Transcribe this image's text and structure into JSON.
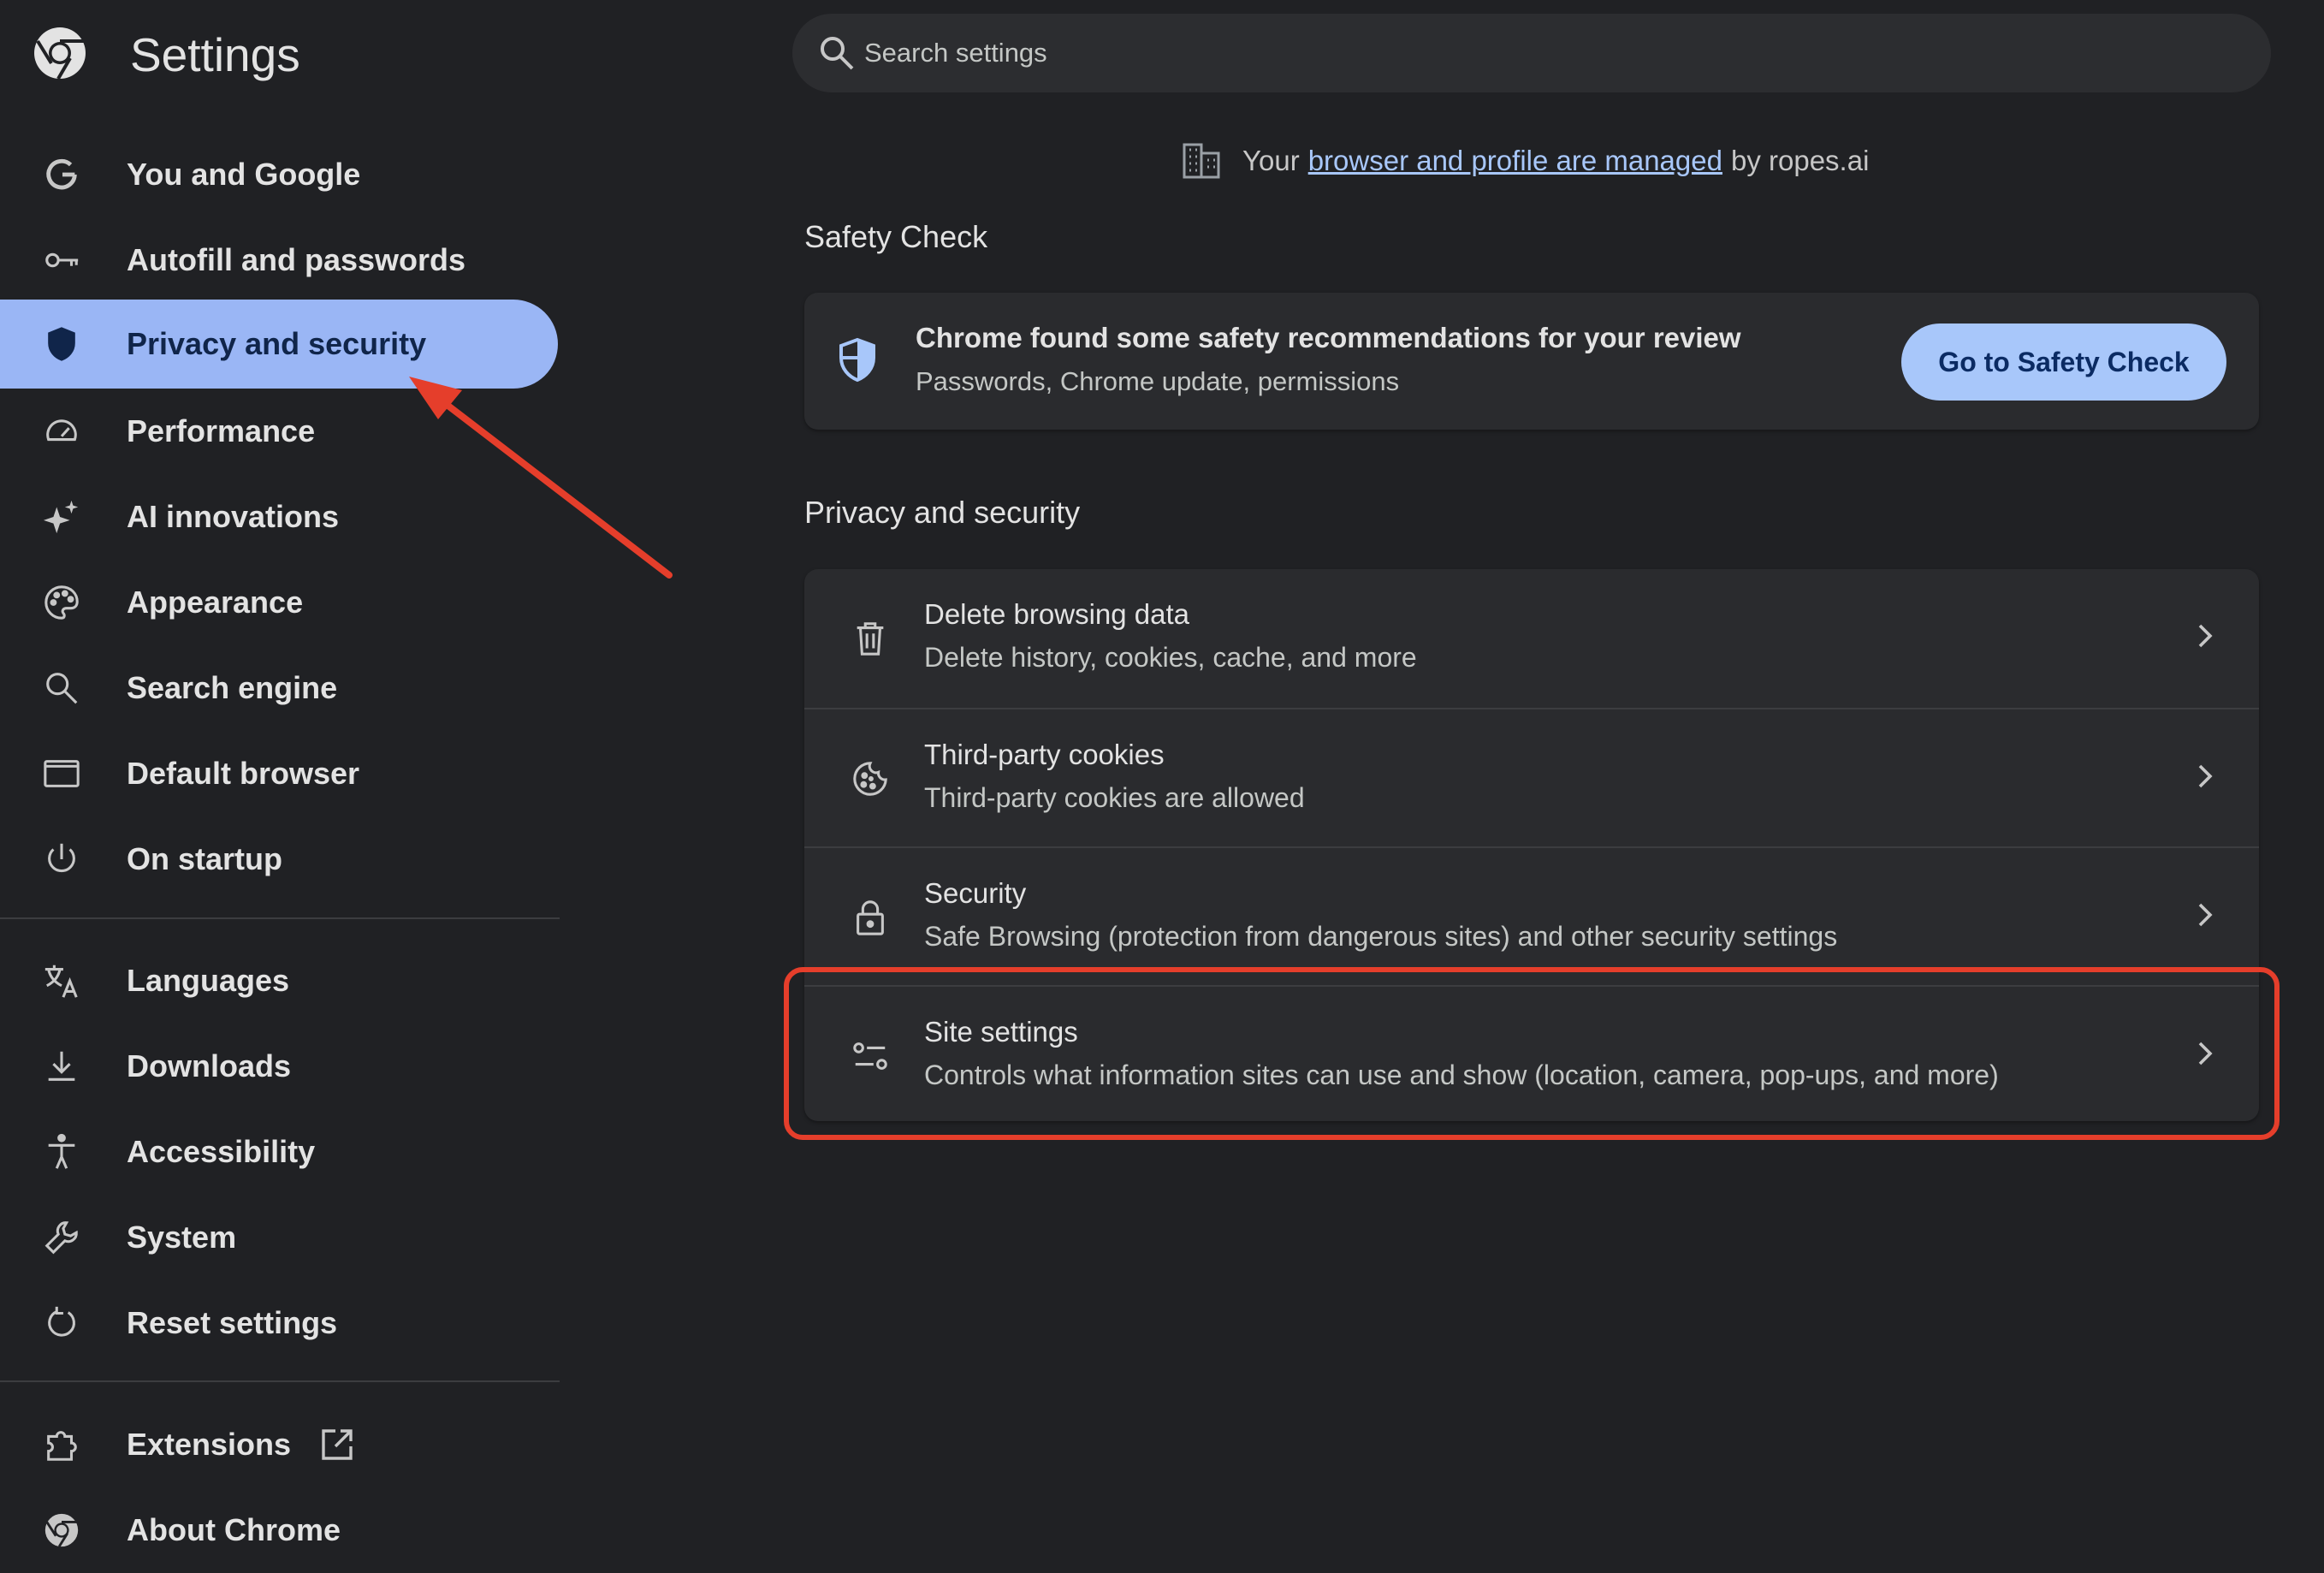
{
  "app": {
    "title": "Settings",
    "icon": "chrome-logo-icon"
  },
  "search": {
    "placeholder": "Search settings",
    "icon": "search-icon"
  },
  "sidebar": {
    "items": [
      {
        "label": "You and Google",
        "icon": "google-g-icon"
      },
      {
        "label": "Autofill and passwords",
        "icon": "key-icon"
      },
      {
        "label": "Privacy and security",
        "icon": "shield-icon",
        "active": true
      },
      {
        "label": "Performance",
        "icon": "speedometer-icon"
      },
      {
        "label": "AI innovations",
        "icon": "sparkle-icon"
      },
      {
        "label": "Appearance",
        "icon": "palette-icon"
      },
      {
        "label": "Search engine",
        "icon": "search-icon"
      },
      {
        "label": "Default browser",
        "icon": "browser-window-icon"
      },
      {
        "label": "On startup",
        "icon": "power-icon"
      },
      {
        "label": "Languages",
        "icon": "translate-icon"
      },
      {
        "label": "Downloads",
        "icon": "download-icon"
      },
      {
        "label": "Accessibility",
        "icon": "accessibility-icon"
      },
      {
        "label": "System",
        "icon": "wrench-icon"
      },
      {
        "label": "Reset settings",
        "icon": "reset-icon"
      },
      {
        "label": "Extensions",
        "icon": "puzzle-icon",
        "external_icon": "open-in-new-icon"
      },
      {
        "label": "About Chrome",
        "icon": "chrome-logo-icon"
      }
    ]
  },
  "managed": {
    "prefix": "Your",
    "link": "browser and profile are managed",
    "suffix": "by ropes.ai",
    "icon": "building-icon"
  },
  "safety_check": {
    "heading": "Safety Check",
    "title": "Chrome found some safety recommendations for your review",
    "subtitle": "Passwords, Chrome update, permissions",
    "button": "Go to Safety Check",
    "icon": "shield-check-icon"
  },
  "privacy": {
    "heading": "Privacy and security",
    "rows": [
      {
        "title": "Delete browsing data",
        "subtitle": "Delete history, cookies, cache, and more",
        "icon": "trash-icon"
      },
      {
        "title": "Third-party cookies",
        "subtitle": "Third-party cookies are allowed",
        "icon": "cookie-icon"
      },
      {
        "title": "Security",
        "subtitle": "Safe Browsing (protection from dangerous sites) and other security settings",
        "icon": "lock-icon"
      },
      {
        "title": "Site settings",
        "subtitle": "Controls what information sites can use and show (location, camera, pop-ups, and more)",
        "icon": "tune-icon",
        "highlighted": true
      }
    ]
  },
  "colors": {
    "background": "#202124",
    "card": "#2a2b2e",
    "active_nav": "#9ab6f5",
    "accent_button": "#a8c7fa",
    "link": "#a8c7fa",
    "annotation": "#e53e2b"
  }
}
